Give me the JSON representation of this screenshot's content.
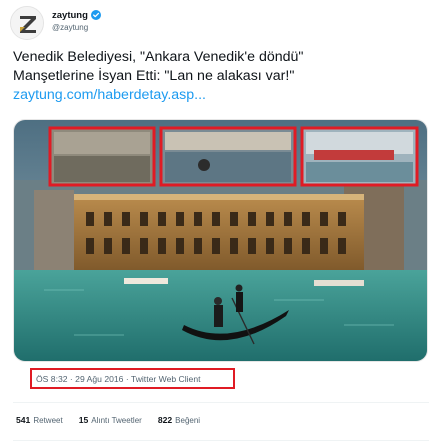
{
  "user": {
    "display_name": "zaytung",
    "handle": "@zaytung",
    "verified": true,
    "avatar_icon": "zaytung-z-logo"
  },
  "tweet": {
    "text_lines": [
      "Venedik Belediyesi, \"Ankara Venedik'e döndü\"",
      "Manşetlerine İsyan Etti: \"Lan ne alakası var!\""
    ],
    "link": "zaytung.com/haberdetay.asp..."
  },
  "media": {
    "description_icon": "venice-gondola-photo",
    "inset_count": 3,
    "highlight_color": "#e01b24"
  },
  "meta": {
    "text": "ÖS 8:32 · 29 Ağu 2016 · Twitter Web Client"
  },
  "stats": [
    {
      "value": "541",
      "label": "Retweet"
    },
    {
      "value": "15",
      "label": "Alıntı Tweetler"
    },
    {
      "value": "822",
      "label": "Beğeni"
    }
  ],
  "colors": {
    "link": "#1d9bf0",
    "secondary_text": "#536471",
    "highlight_border": "#e01b24"
  }
}
